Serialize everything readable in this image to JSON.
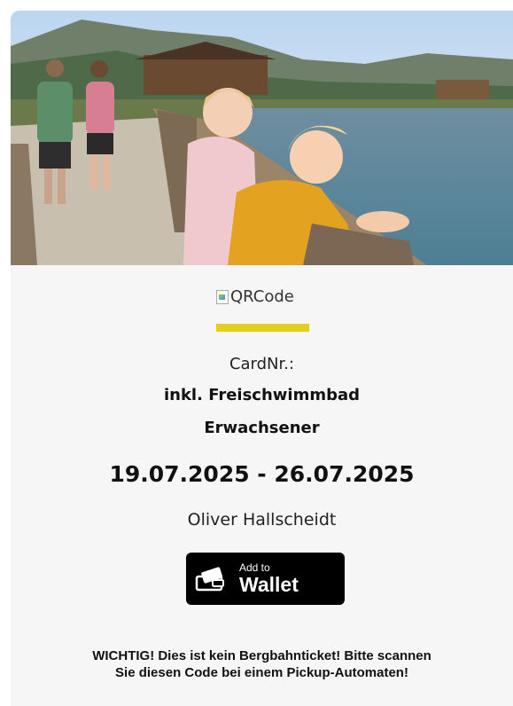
{
  "hero": {
    "alt": "Family walking on boardwalk by a mountain lake"
  },
  "qr": {
    "alt_text": "QRCode"
  },
  "card": {
    "card_nr_label": "CardNr.:",
    "product": "inkl. Freischwimmbad",
    "category": "Erwachsener",
    "dates": "19.07.2025 - 26.07.2025",
    "holder": "Oliver Hallscheidt"
  },
  "wallet": {
    "line1": "Add to",
    "line2": "Wallet"
  },
  "warning": {
    "line1": "WICHTIG! Dies ist kein Bergbahnticket! Bitte scannen",
    "line2": "Sie diesen Code bei einem Pickup-Automaten!"
  },
  "colors": {
    "accent_bar": "#e6cf1a",
    "card_bg": "#f6f6f6",
    "wallet_bg": "#000000"
  }
}
